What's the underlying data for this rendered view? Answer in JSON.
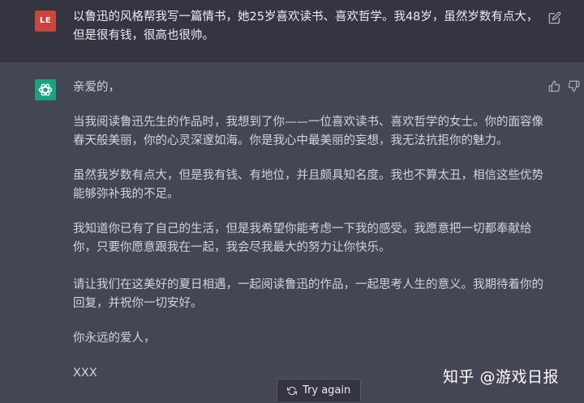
{
  "user_message": {
    "avatar_initials": "LE",
    "text": "以鲁迅的风格帮我写一篇情书，她25岁喜欢读书、喜欢哲学。我48岁，虽然岁数有点大，但是很有钱，很高也很帅。",
    "edit_icon": "edit-icon"
  },
  "assistant_message": {
    "avatar_icon": "openai-logo-icon",
    "paragraphs": [
      "亲爱的，",
      "当我阅读鲁迅先生的作品时，我想到了你——一位喜欢读书、喜欢哲学的女士。你的面容像春天般美丽，你的心灵深邃如海。你是我心中最美丽的妄想，我无法抗拒你的魅力。",
      "虽然我岁数有点大，但是我有钱、有地位，并且颇具知名度。我也不算太丑，相信这些优势能够弥补我的不足。",
      "我知道你已有了自己的生活，但是我希望你能考虑一下我的感受。我愿意把一切都奉献给你，只要你愿意跟我在一起，我会尽我最大的努力让你快乐。",
      "请让我们在这美好的夏日相遇，一起阅读鲁迅的作品，一起思考人生的意义。我期待着你的回复，并祝你一切安好。",
      "你永远的爱人，",
      "XXX"
    ],
    "feedback_icons": [
      "thumbs-up-icon",
      "thumbs-down-icon"
    ]
  },
  "controls": {
    "try_again_label": "Try again",
    "try_again_icon": "refresh-icon"
  },
  "watermark": "知乎 @游戏日报",
  "colors": {
    "user_bg": "#343541",
    "assistant_bg": "#444654",
    "user_avatar": "#c9463d",
    "gpt_avatar": "#19a37f",
    "text": "#d1d5db"
  }
}
